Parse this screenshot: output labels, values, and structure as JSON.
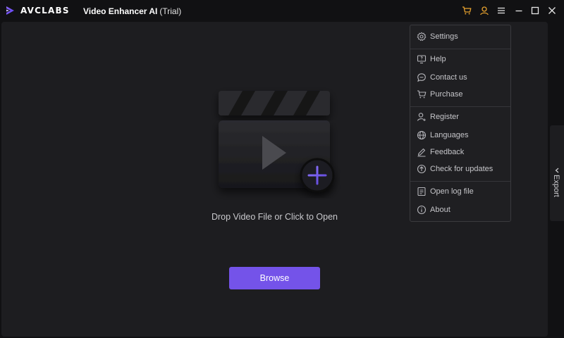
{
  "app": {
    "brand": "AVCLABS",
    "title": "Video Enhancer AI",
    "edition": "(Trial)",
    "accent": "#7453e9",
    "icon_accent": "#e8a22e"
  },
  "titlebar": {
    "icons": [
      "cart-icon",
      "user-icon",
      "menu-icon",
      "minimize-icon",
      "maximize-icon",
      "close-icon"
    ]
  },
  "main": {
    "drop_text": "Drop Video File or Click to Open",
    "browse_label": "Browse"
  },
  "side_tab": {
    "label": "Export"
  },
  "menu": {
    "items": [
      {
        "label": "Settings",
        "icon": "gear-icon"
      },
      {
        "label": "Help",
        "icon": "help-icon"
      },
      {
        "label": "Contact us",
        "icon": "chat-icon"
      },
      {
        "label": "Purchase",
        "icon": "cart-icon"
      },
      {
        "label": "Register",
        "icon": "register-icon"
      },
      {
        "label": "Languages",
        "icon": "globe-icon"
      },
      {
        "label": "Feedback",
        "icon": "pencil-icon"
      },
      {
        "label": "Check for updates",
        "icon": "update-icon"
      },
      {
        "label": "Open log file",
        "icon": "file-icon"
      },
      {
        "label": "About",
        "icon": "info-icon"
      }
    ]
  }
}
